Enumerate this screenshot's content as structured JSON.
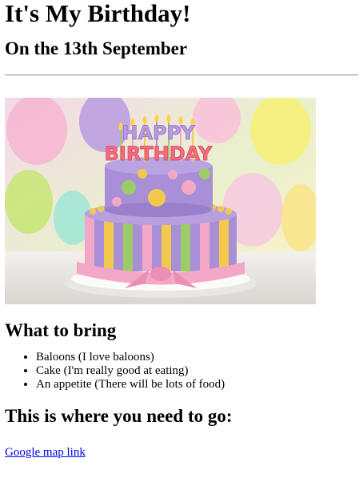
{
  "title": "It's My Birthday!",
  "date_heading": "On the 13th September",
  "image": {
    "cake_topper_top": "HAPPY",
    "cake_topper_bottom": "BIRTHDAY"
  },
  "bring": {
    "heading": "What to bring",
    "items": [
      "Baloons (I love baloons)",
      "Cake (I'm really good at eating)",
      "An appetite (There will be lots of food)"
    ]
  },
  "directions": {
    "heading": "This is where you need to go:",
    "link_text": "Google map link"
  },
  "colors": {
    "link": "#0000ee",
    "cake_purple": "#a98fd6",
    "cake_pink": "#f2a7c7",
    "cake_yellow": "#f2c94c",
    "cake_green": "#9ccc65"
  }
}
